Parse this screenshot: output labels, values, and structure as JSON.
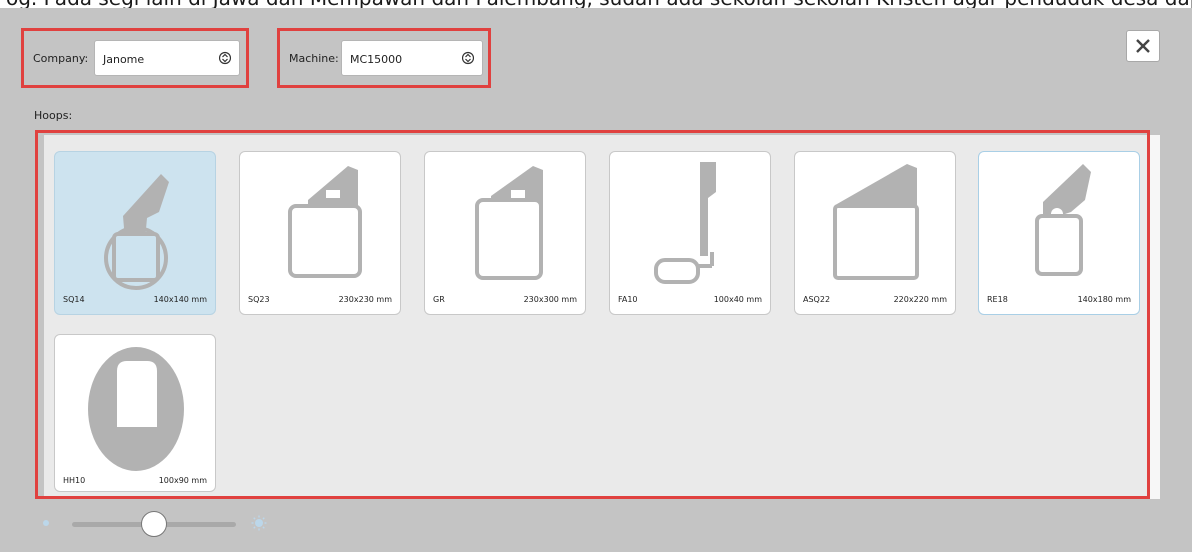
{
  "caption": "og. Pada segi lain di Jawa dan Mempawah dan Palembang, sudah ada sekolah-sekolah Kristen agar penduduk desa dapat berbahasa",
  "company": {
    "label": "Company:",
    "value": "Janome"
  },
  "machine": {
    "label": "Machine:",
    "value": "MC15000"
  },
  "hoops_label": "Hoops:",
  "hoops": [
    {
      "name": "SQ14",
      "size": "140x140 mm",
      "state": "selected"
    },
    {
      "name": "SQ23",
      "size": "230x230 mm",
      "state": "normal"
    },
    {
      "name": "GR",
      "size": "230x300 mm",
      "state": "normal"
    },
    {
      "name": "FA10",
      "size": "100x40 mm",
      "state": "normal"
    },
    {
      "name": "ASQ22",
      "size": "220x220 mm",
      "state": "normal"
    },
    {
      "name": "RE18",
      "size": "140x180 mm",
      "state": "hover"
    },
    {
      "name": "HH10",
      "size": "100x90 mm",
      "state": "normal"
    }
  ],
  "zoom": {
    "level": 0.5
  },
  "colors": {
    "highlight": "#e0413f",
    "selected_card": "#cde3ef",
    "hoop_shape": "#b2b2b2",
    "panel_bg": "#c4c4c4"
  },
  "icons": {
    "close": "close-icon",
    "chevron": "chevron-updown-icon",
    "zoom_out": "sun-small-icon",
    "zoom_in": "sun-large-icon"
  }
}
